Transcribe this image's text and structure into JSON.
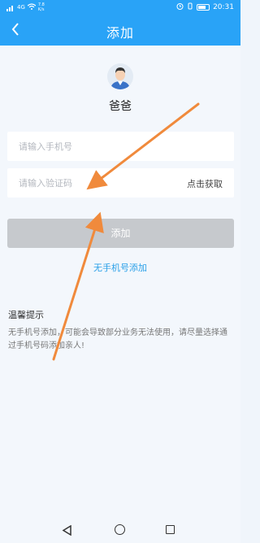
{
  "status_bar": {
    "time": "20:31",
    "network": "4G",
    "speed": "7.8",
    "speed_unit": "K/s",
    "battery_icon": "battery-icon"
  },
  "nav": {
    "title": "添加",
    "back_icon": "chevron-left-icon"
  },
  "profile": {
    "name": "爸爸",
    "avatar_icon": "avatar-icon"
  },
  "form": {
    "phone_placeholder": "请输入手机号",
    "code_placeholder": "请输入验证码",
    "get_code_label": "点击获取",
    "submit_label": "添加",
    "no_phone_link": "无手机号添加"
  },
  "tips": {
    "title": "温馨提示",
    "text": "无手机号添加，可能会导致部分业务无法使用，请尽量选择通过手机号码添加亲人!"
  },
  "colors": {
    "primary": "#29a3f7",
    "link": "#2aa0e8",
    "button_disabled": "#c6c9cd",
    "annotation_arrow": "#f08a3c"
  },
  "system_nav": {
    "back_icon": "triangle-back-icon",
    "home_icon": "circle-home-icon",
    "recent_icon": "square-recent-icon"
  }
}
